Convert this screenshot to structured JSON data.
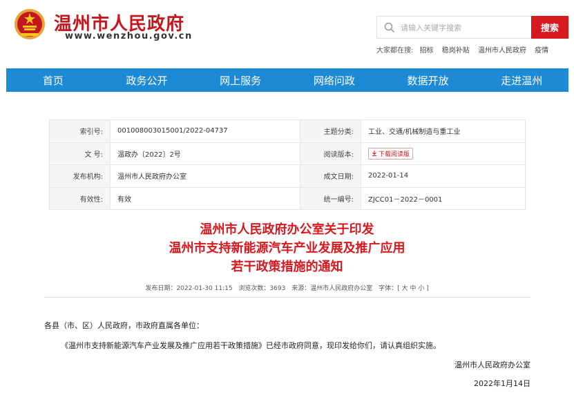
{
  "header": {
    "site_title": "温州市人民政府",
    "site_url": "www.wenzhou.gov.cn",
    "search_placeholder": "请输入关键字搜索",
    "search_button": "搜索",
    "hot_search_label": "大家都在搜:",
    "hot_search_items": [
      "招标",
      "稳岗补贴",
      "温州市人民政府",
      "疫情"
    ]
  },
  "nav": {
    "items": [
      "首页",
      "政务公开",
      "网上服务",
      "网络问政",
      "数据开放",
      "走进温州"
    ]
  },
  "meta": {
    "rows": [
      {
        "l1": "索引号:",
        "v1": "001008003015001/2022-04737",
        "l2": "主题分类:",
        "v2": "工业、交通/机械制造与重工业"
      },
      {
        "l1": "文 号:",
        "v1": "温政办〔2022〕2号",
        "l2": "阅读版本:",
        "v2": "下载阅读版"
      },
      {
        "l1": "发布机构:",
        "v1": "温州市人民政府办公室",
        "l2": "成文日期:",
        "v2": "2022-01-14"
      },
      {
        "l1": "有效性:",
        "v1": "有效",
        "l2": "统一编号:",
        "v2": "ZJCC01－2022－0001"
      }
    ]
  },
  "article": {
    "title_line1": "温州市人民政府办公室关于印发",
    "title_line2": "温州市支持新能源汽车产业发展及推广应用",
    "title_line3": "若干政策措施的通知",
    "publish_date": "发布日期：2022-01-30 11:15",
    "views": "浏览次数：3693",
    "source": "来源：温州市人民政府办公室",
    "font_size": "字体：[ 大 中 小 ]",
    "salutation": "各县（市、区）人民政府，市政府直属各单位：",
    "body": "《温州市支持新能源汽车产业发展及推广应用若干政策措施》已经市政府同意，现印发给你们，请认真组织实施。",
    "signature": "温州市人民政府办公室",
    "date": "2022年1月14日"
  },
  "colors": {
    "brand_red": "#d7191f",
    "nav_blue": "#1e89d5"
  }
}
